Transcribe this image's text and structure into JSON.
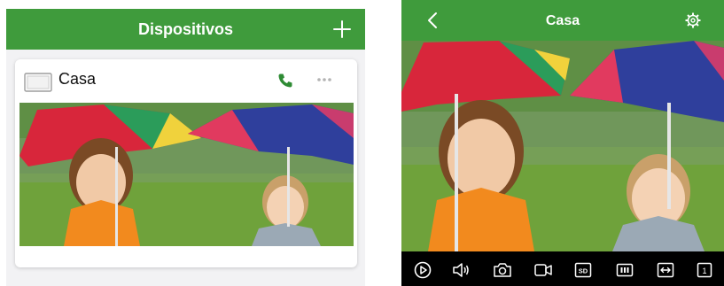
{
  "device_list": {
    "header": {
      "title": "Dispositivos",
      "add_icon": "plus-icon"
    },
    "card": {
      "name": "Casa",
      "camera_icon": "camera-device-icon",
      "call_icon": "phone-icon",
      "more_icon": "more-dots-icon"
    }
  },
  "live_view": {
    "header": {
      "title": "Casa",
      "back_icon": "chevron-left-icon",
      "settings_icon": "gear-icon"
    },
    "controls": [
      {
        "name": "play-icon"
      },
      {
        "name": "speaker-icon"
      },
      {
        "name": "snapshot-camera-icon"
      },
      {
        "name": "record-video-icon"
      },
      {
        "name": "sd-card-icon",
        "label": "SD"
      },
      {
        "name": "quality-bars-icon"
      },
      {
        "name": "fit-screen-icon"
      },
      {
        "name": "channel-icon",
        "label": "1"
      }
    ]
  },
  "colors": {
    "header_green": "#3f9b3c",
    "call_green": "#2e8b34",
    "control_bg": "#000000"
  }
}
